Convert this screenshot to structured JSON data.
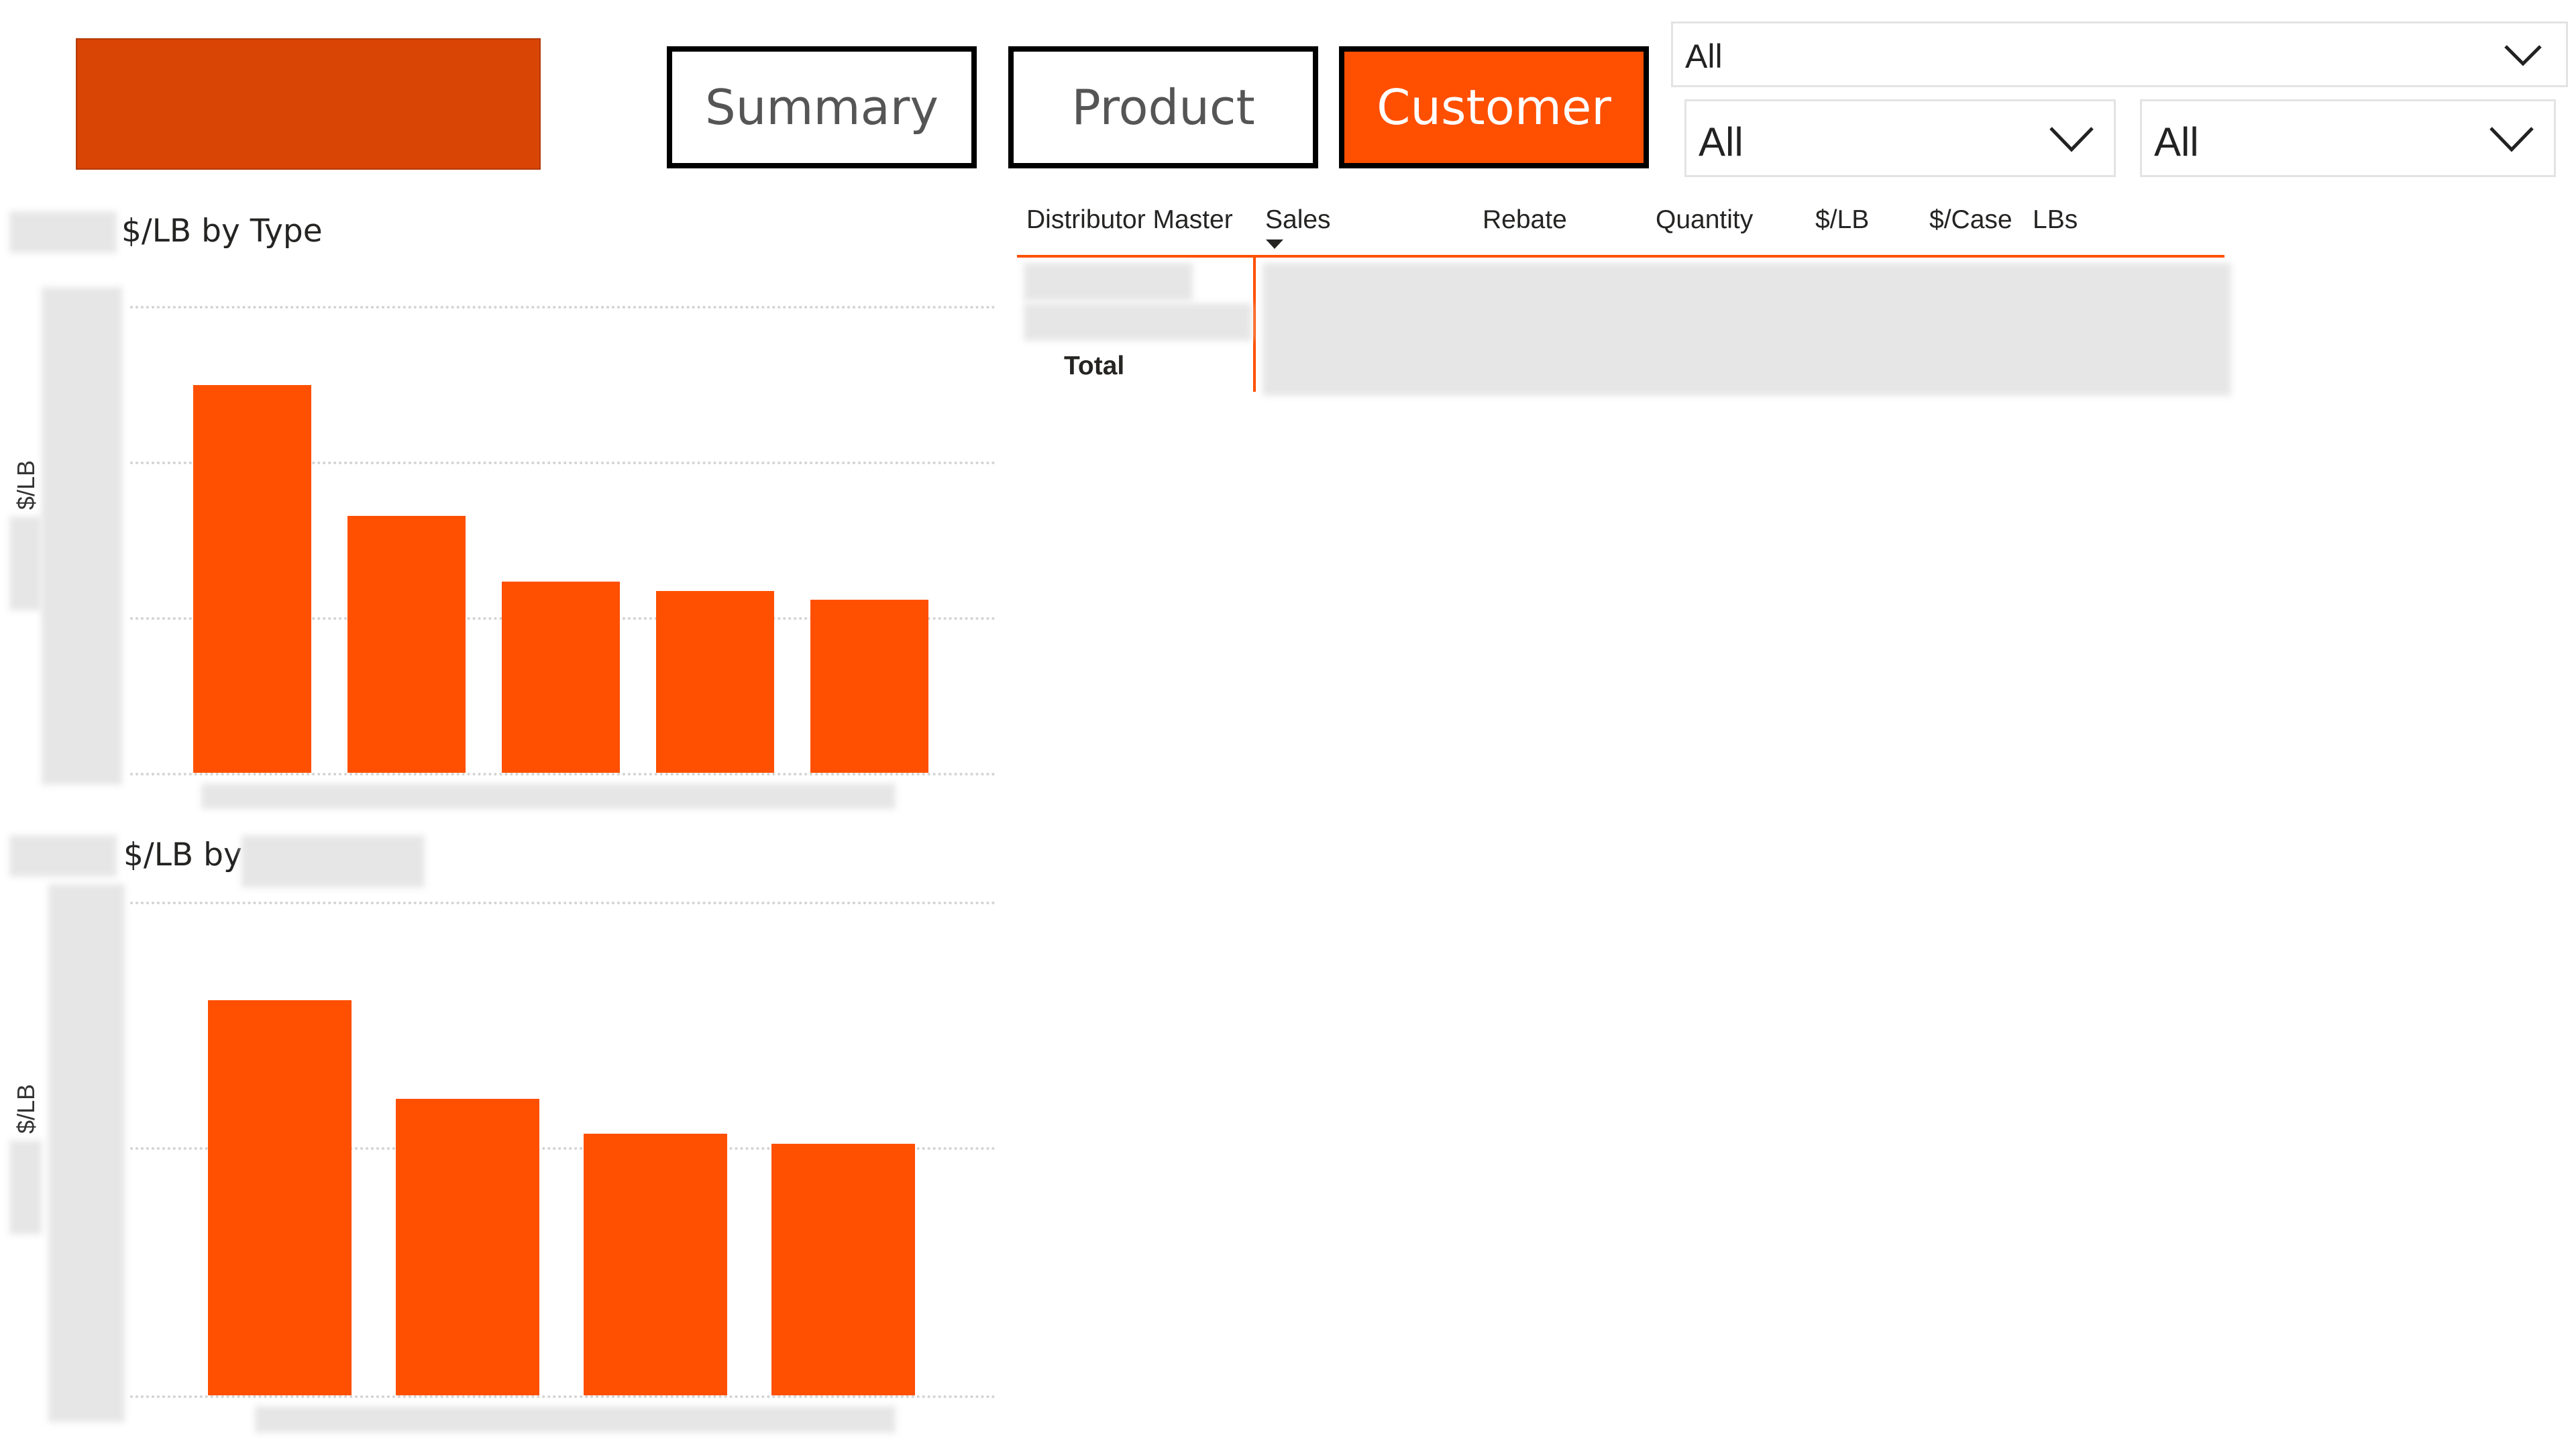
{
  "colors": {
    "accent": "#FF4F00",
    "logo": "#D94505"
  },
  "nav": [
    {
      "label": "Summary",
      "active": false
    },
    {
      "label": "Product",
      "active": false
    },
    {
      "label": "Customer",
      "active": true
    }
  ],
  "slicers": {
    "top": {
      "value": "All",
      "icon": "chevron-down-icon"
    },
    "left": {
      "value": "All",
      "icon": "chevron-down-icon"
    },
    "right": {
      "value": "All",
      "icon": "chevron-down-icon"
    }
  },
  "chart1": {
    "title": "$/LB by Type",
    "ylabel": "$/LB"
  },
  "chart2": {
    "title": "$/LB by",
    "ylabel": "$/LB"
  },
  "chart_data": [
    {
      "type": "bar",
      "title": "$/LB by Type",
      "ylabel": "$/LB",
      "grid": true,
      "values": [
        0.83,
        0.55,
        0.41,
        0.39,
        0.37
      ]
    },
    {
      "type": "bar",
      "title": "$/LB by",
      "ylabel": "$/LB",
      "grid": true,
      "values": [
        0.8,
        0.6,
        0.53,
        0.51
      ]
    }
  ],
  "table": {
    "columns": [
      "Distributor Master",
      "Sales",
      "Rebate",
      "Quantity",
      "$/LB",
      "$/Case",
      "LBs"
    ],
    "total_label": "Total",
    "sort_icon": "sort-descending-icon"
  }
}
